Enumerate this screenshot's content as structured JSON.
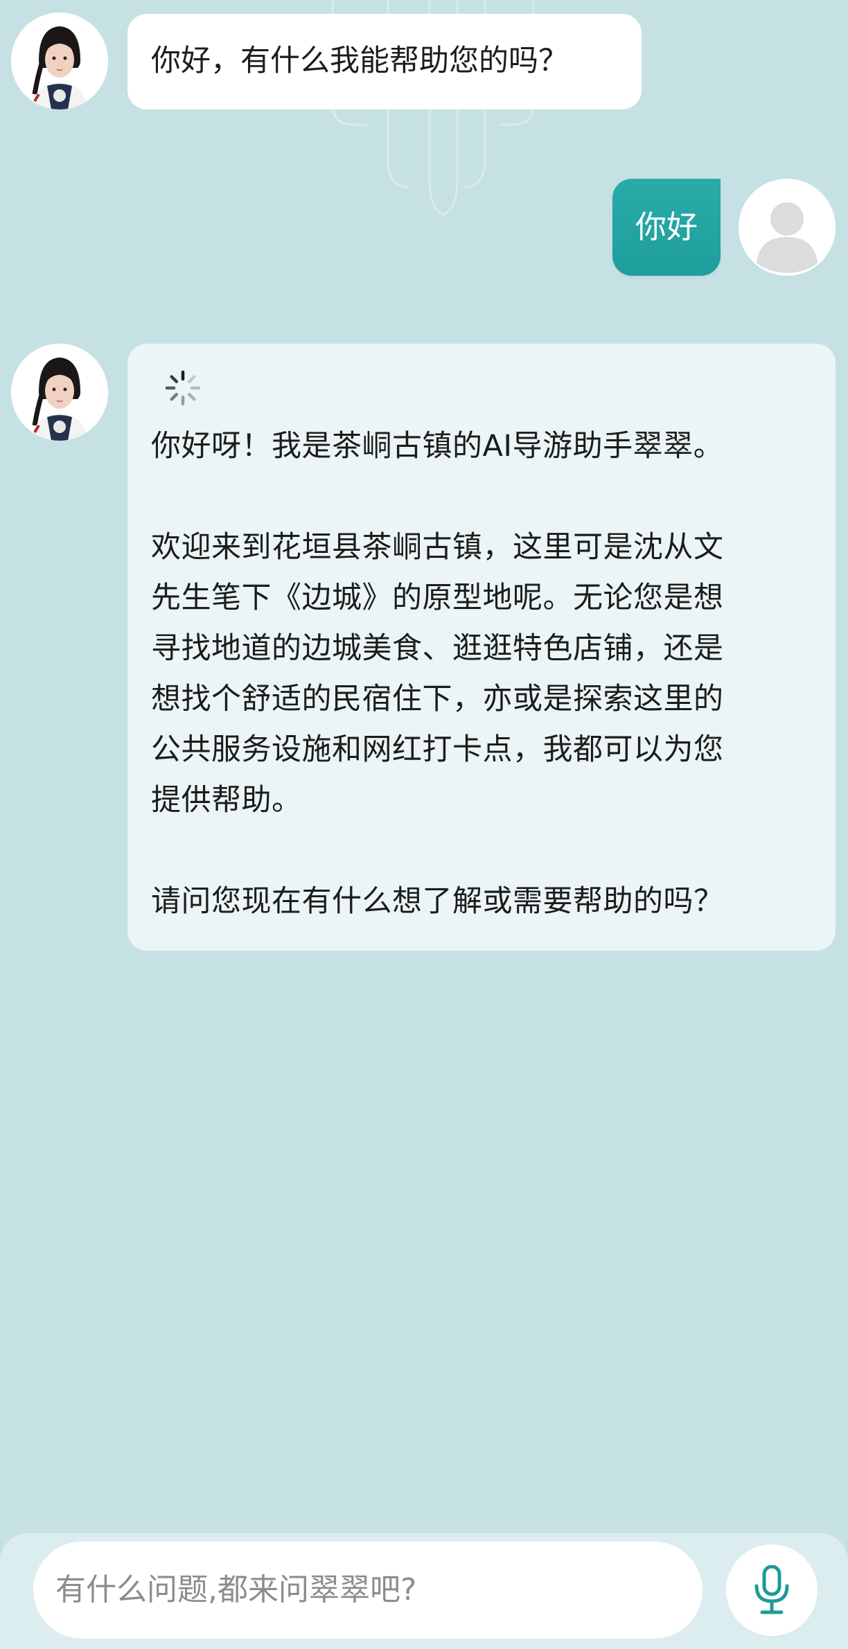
{
  "chat": {
    "greeting": "你好，有什么我能帮助您的吗？",
    "user_message": "你好",
    "reply": {
      "p1": "你好呀！我是茶峒古镇的AI导游助手翠翠。",
      "p2_lines": [
        "欢迎来到花垣县茶峒古镇，这里可是沈从文",
        "先生笔下《边城》的原型地呢。无论您是想",
        "寻找地道的边城美食、逛逛特色店铺，还是",
        "想找个舒适的民宿住下，亦或是探索这里的",
        "公共服务设施和网红打卡点，我都可以为您",
        "提供帮助。"
      ],
      "p3": "请问您现在有什么想了解或需要帮助的吗？"
    }
  },
  "input": {
    "placeholder": "有什么问题,都来问翠翠吧?"
  },
  "icons": {
    "assistant_avatar": "assistant-avatar",
    "user_avatar": "user-avatar-icon",
    "loading": "loading-spinner-icon",
    "mic": "microphone-icon"
  },
  "colors": {
    "background": "#c5e1e3",
    "user_bubble": "#22a5a4",
    "assistant_bubble": "#ffffff",
    "reply_bubble": "#ebf5f5",
    "accent": "#1e9a98"
  }
}
